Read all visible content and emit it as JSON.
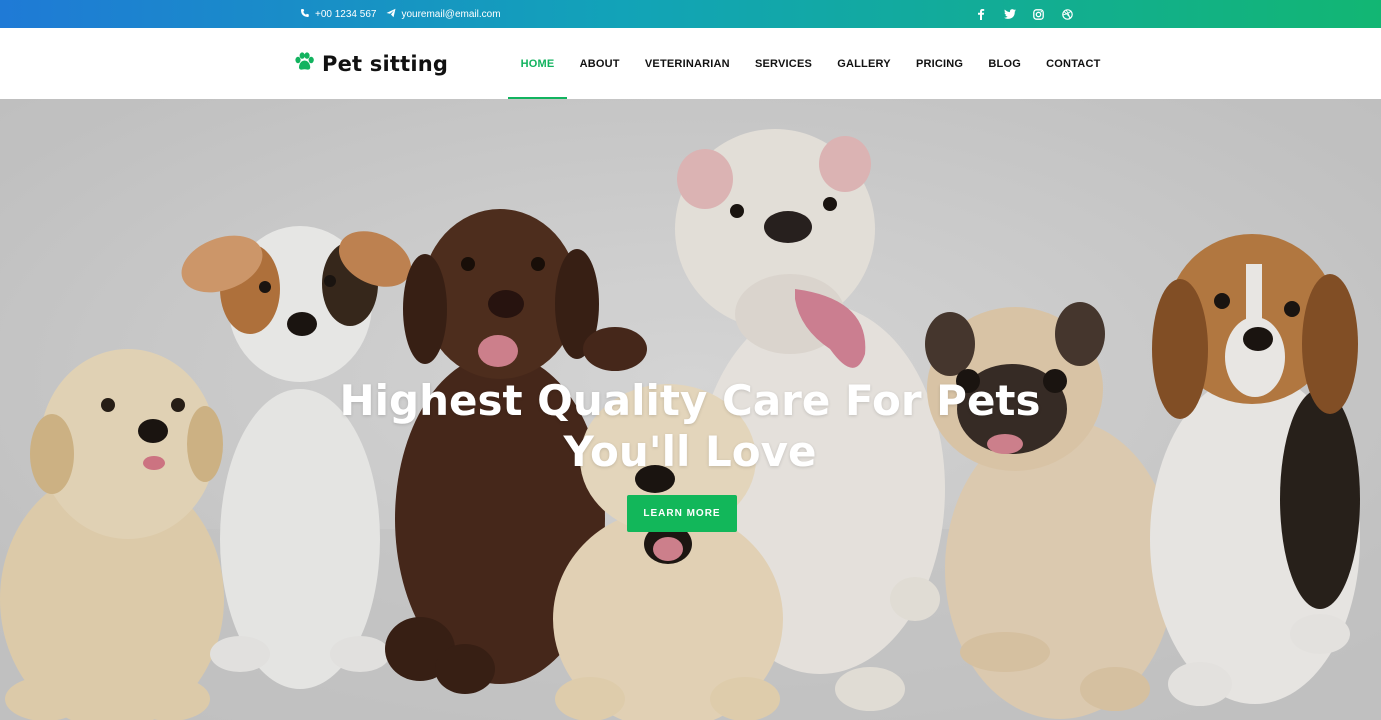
{
  "topbar": {
    "phone": "+00 1234 567",
    "email": "youremail@email.com",
    "social": [
      "facebook-icon",
      "twitter-icon",
      "instagram-icon",
      "dribbble-icon"
    ]
  },
  "header": {
    "brand": "Pet sitting",
    "nav": [
      {
        "label": "HOME",
        "active": true
      },
      {
        "label": "ABOUT"
      },
      {
        "label": "VETERINARIAN"
      },
      {
        "label": "SERVICES"
      },
      {
        "label": "GALLERY"
      },
      {
        "label": "PRICING"
      },
      {
        "label": "BLOG"
      },
      {
        "label": "CONTACT"
      }
    ]
  },
  "hero": {
    "title_line1": "Highest Quality Care For Pets",
    "title_line2": "You'll Love",
    "cta": "LEARN MORE",
    "image": "group-of-puppies-photo"
  },
  "colors": {
    "accent": "#12b35f",
    "topbar_start": "#1f7ad6",
    "topbar_end": "#12b673",
    "hero_bg": "#d6d6d6"
  }
}
